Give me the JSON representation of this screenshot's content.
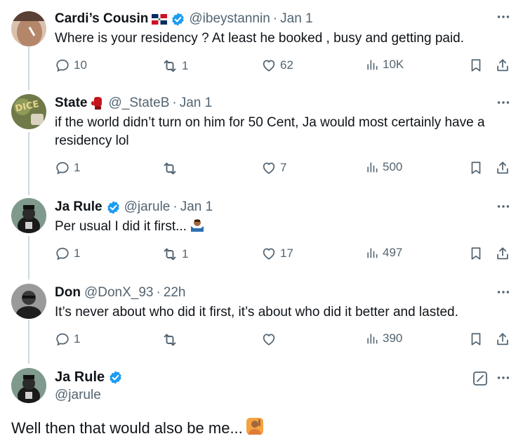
{
  "replies": [
    {
      "name": "Cardi’s Cousin",
      "handle": "@ibeystannin",
      "time": "Jan 1",
      "text": "Where is your residency ? At least he booked , busy and getting paid.",
      "replies_count": "10",
      "reposts_count": "1",
      "likes_count": "62",
      "views_count": "10K"
    },
    {
      "name": "State",
      "handle": "@_StateB",
      "time": "Jan 1",
      "text_line1": "if the world didn’t turn on him for 50 Cent, Ja would most certainly have a",
      "text_line2": "residency lol",
      "replies_count": "1",
      "reposts_count": "",
      "likes_count": "7",
      "views_count": "500"
    },
    {
      "name": "Ja Rule",
      "handle": "@jarule",
      "time": "Jan 1",
      "text": "Per usual I did it first...",
      "replies_count": "1",
      "reposts_count": "1",
      "likes_count": "17",
      "views_count": "497"
    },
    {
      "name": "Don",
      "handle": "@DonX_93",
      "time": "22h",
      "text": "It’s never about who did it first, it’s about who did it better and lasted.",
      "replies_count": "1",
      "reposts_count": "",
      "likes_count": "",
      "views_count": "390"
    }
  ],
  "main_tweet": {
    "name": "Ja Rule",
    "handle": "@jarule",
    "text": "Well then that would also be me..."
  },
  "separator": "·",
  "icons": {
    "reply": "reply-icon",
    "repost": "repost-icon",
    "like": "heart-icon",
    "views": "views-icon",
    "bookmark": "bookmark-icon",
    "share": "share-icon",
    "more": "more-icon",
    "verified": "verified-badge-icon",
    "edit": "edit-icon"
  },
  "colors": {
    "text": "#0f1419",
    "secondary": "#536471",
    "verified": "#1d9bf0",
    "thread_line": "#cfd9de"
  }
}
